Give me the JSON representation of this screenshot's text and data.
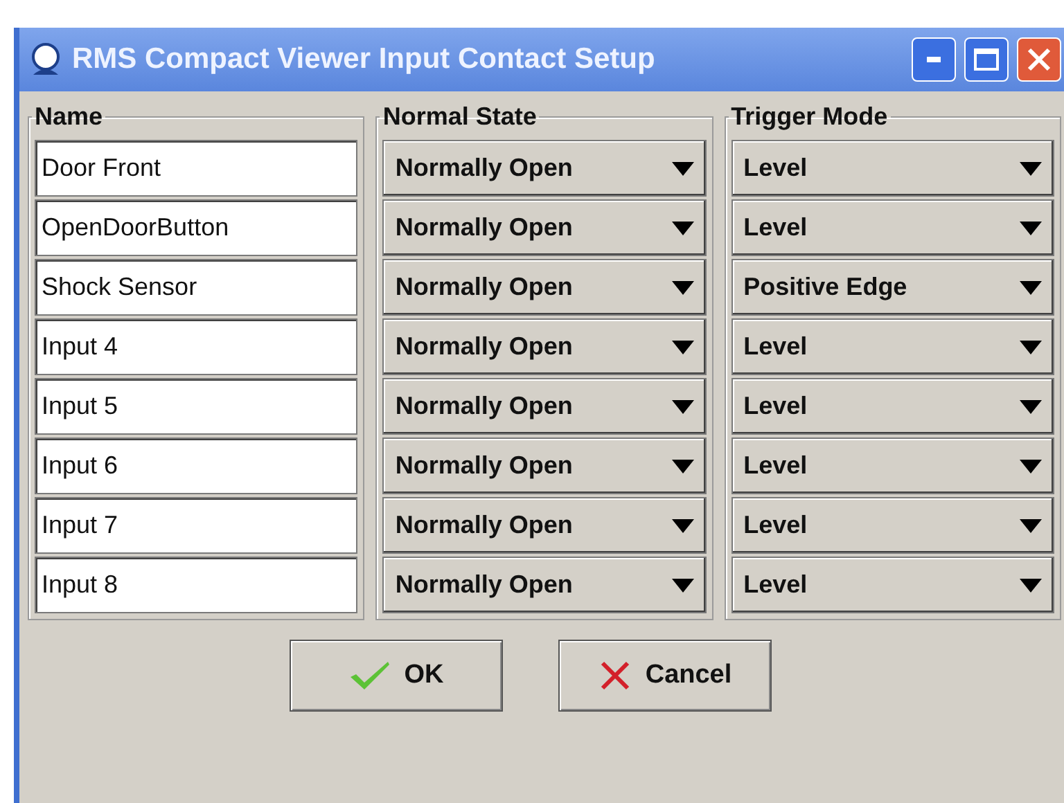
{
  "window": {
    "title": "RMS Compact Viewer Input Contact Setup"
  },
  "groups": [
    {
      "kind": "names",
      "title": "Name"
    },
    {
      "kind": "state",
      "title": "Normal State"
    },
    {
      "kind": "trigger",
      "title": "Trigger Mode"
    }
  ],
  "inputs": [
    {
      "name": "Door Front",
      "normal_state": "Normally Open",
      "trigger_mode": "Level"
    },
    {
      "name": "OpenDoorButton",
      "normal_state": "Normally Open",
      "trigger_mode": "Level"
    },
    {
      "name": "Shock Sensor",
      "normal_state": "Normally Open",
      "trigger_mode": "Positive Edge"
    },
    {
      "name": "Input 4",
      "normal_state": "Normally Open",
      "trigger_mode": "Level"
    },
    {
      "name": "Input 5",
      "normal_state": "Normally Open",
      "trigger_mode": "Level"
    },
    {
      "name": "Input 6",
      "normal_state": "Normally Open",
      "trigger_mode": "Level"
    },
    {
      "name": "Input 7",
      "normal_state": "Normally Open",
      "trigger_mode": "Level"
    },
    {
      "name": "Input 8",
      "normal_state": "Normally Open",
      "trigger_mode": "Level"
    }
  ],
  "buttons": [
    {
      "kind": "ok",
      "label": "OK"
    },
    {
      "kind": "cancel",
      "label": "Cancel"
    }
  ]
}
